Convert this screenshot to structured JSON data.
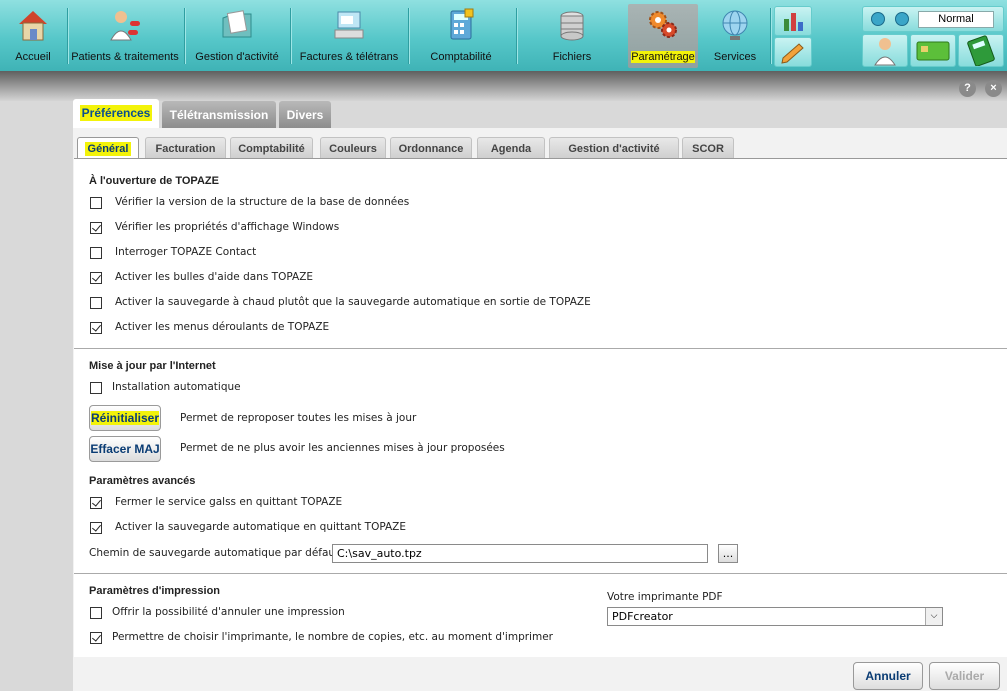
{
  "toolbar": {
    "items": [
      {
        "label": "Accueil",
        "icon": "house-icon"
      },
      {
        "label": "Patients & traitements",
        "icon": "doctor-pills-icon"
      },
      {
        "label": "Gestion d'activité",
        "icon": "folder-icon"
      },
      {
        "label": "Factures & télétrans",
        "icon": "computer-icon"
      },
      {
        "label": "Comptabilité",
        "icon": "calculator-icon"
      },
      {
        "label": "Fichiers",
        "icon": "database-icon"
      },
      {
        "label": "Paramétrage",
        "icon": "gears-icon"
      },
      {
        "label": "Services",
        "icon": "globe-icon"
      }
    ],
    "mode_value": "Normal"
  },
  "main_tabs": [
    "Préférences",
    "Télétransmission",
    "Divers"
  ],
  "sub_tabs": [
    "Général",
    "Facturation",
    "Comptabilité",
    "Couleurs",
    "Ordonnance",
    "Agenda",
    "Gestion d'activité",
    "SCOR"
  ],
  "help_label": "?",
  "close_label": "×",
  "opening": {
    "title": "À l'ouverture de TOPAZE",
    "options": [
      {
        "label": "Vérifier la version de la structure de la base de données",
        "checked": false
      },
      {
        "label": "Vérifier les propriétés d'affichage Windows",
        "checked": true
      },
      {
        "label": "Interroger TOPAZE Contact",
        "checked": false
      },
      {
        "label": "Activer les bulles d'aide dans TOPAZE",
        "checked": true
      },
      {
        "label": "Activer la sauvegarde à chaud plutôt que la sauvegarde automatique en sortie de TOPAZE",
        "checked": false
      },
      {
        "label": "Activer les menus déroulants de TOPAZE",
        "checked": true
      }
    ]
  },
  "update": {
    "title": "Mise à jour par l'Internet",
    "auto_install": {
      "label": "Installation automatique",
      "checked": false
    },
    "reset_button": "Réinitialiser",
    "reset_desc": "Permet de reproposer toutes les mises à jour",
    "clear_button": "Effacer MAJ",
    "clear_desc": "Permet de ne plus avoir les anciennes mises à jour proposées"
  },
  "advanced": {
    "title": "Paramètres avancés",
    "options": [
      {
        "label": "Fermer le service galss en quittant TOPAZE",
        "checked": true
      },
      {
        "label": "Activer la sauvegarde automatique en quittant TOPAZE",
        "checked": true
      }
    ],
    "path_label": "Chemin de sauvegarde automatique par défaut :",
    "path_value": "C:\\sav_auto.tpz",
    "browse_label": "..."
  },
  "printing": {
    "title": "Paramètres d'impression",
    "options": [
      {
        "label": "Offrir la possibilité d'annuler une impression",
        "checked": false
      },
      {
        "label": "Permettre de choisir l'imprimante, le nombre de copies, etc. au moment d'imprimer",
        "checked": true
      }
    ],
    "pdf_label": "Votre imprimante PDF",
    "pdf_value": "PDFcreator"
  },
  "footer": {
    "cancel": "Annuler",
    "validate": "Valider"
  },
  "colors": {
    "highlight": "#f3f30a",
    "toolbar": "#56c7c9",
    "accent_text": "#0a3c74"
  }
}
